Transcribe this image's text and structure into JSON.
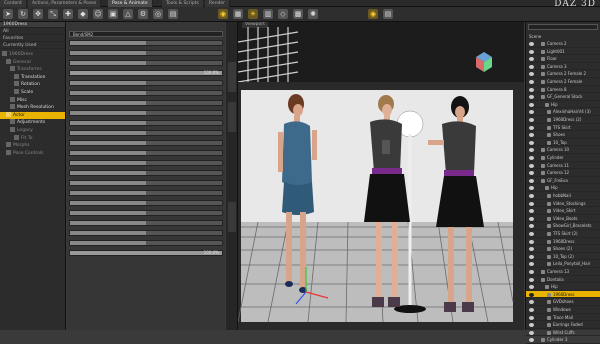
{
  "tabs": [
    "Content",
    "Actions, Parameters & Poses",
    "Pose & Animate",
    "Tools & Scripts",
    "Render"
  ],
  "active_tab_index": 2,
  "logo": "DAZ 3D",
  "left_panel": {
    "dropdown": "1960Dress",
    "items": [
      "All",
      "Favorites",
      "Currently Used"
    ],
    "tree": [
      "1960Dress",
      "General",
      "Transforms",
      "Translation",
      "Rotation",
      "Scale",
      "Misc",
      "Mesh Resolution",
      "Actor",
      "Adjustments",
      "Legacy",
      "Fit To",
      "Morphs",
      "Pose Controls"
    ],
    "selected_tree_item": "Actor"
  },
  "middle_panel": {
    "header_field": "Bend/SM2",
    "percent_values": [
      "100.0%",
      "100.0%"
    ]
  },
  "viewport": {
    "label": "Viewport",
    "grid_color": "#555555",
    "sky_color": "#e8e8e8"
  },
  "right_panel": {
    "header": "Scene",
    "items": [
      "Camera 2",
      "Light001",
      "Floor",
      "Camera 3",
      "Camera 2 Female 2",
      "Camera 2 Female",
      "Camera 8",
      "GF_General Stock",
      "Hip",
      "AlexinhaHairV4 (3)",
      "1960Dress (2)",
      "TFS Skirt",
      "Shoes",
      "10_Top",
      "Camera 10",
      "Cylinder",
      "Camera 11",
      "Camera 12",
      "GF_FreEva",
      "Hip",
      "hobbNail",
      "Video_Stockings",
      "Video_Skirt",
      "Video_Boots",
      "ShowGirl_Bracelets",
      "TFS Skirt (2)",
      "1960Dress",
      "Shoes (2)",
      "10_Top (2)",
      "Leila_Ponytail_Hair",
      "Camera 13",
      "Dontalia",
      "Hip",
      "1960Dress",
      "GVDshoes",
      "Windows",
      "Trace Mail",
      "Earrings Faded",
      "Wrist Cuffs",
      "Cylinder 3"
    ],
    "selected": "1960Dress"
  },
  "icons": {
    "toolbar": [
      "pointer-icon",
      "rotate-icon",
      "translate-icon",
      "scale-icon",
      "universal-icon",
      "node-weight-icon",
      "active-pose-icon",
      "surface-icon",
      "light-icon",
      "spot-icon"
    ]
  }
}
